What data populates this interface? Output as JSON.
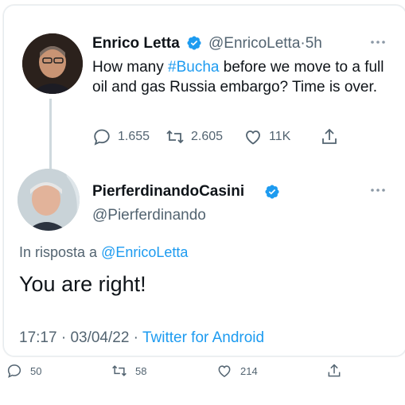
{
  "tweet1": {
    "author_name": "Enrico Letta",
    "handle": "@EnricoLetta",
    "separator": "·",
    "time": "5h",
    "text_before": "How many ",
    "hashtag": "#Bucha",
    "text_after": " before we move to a full oil and gas Russia embargo? Time is over.",
    "replies": "1.655",
    "retweets": "2.605",
    "likes": "11K"
  },
  "tweet2": {
    "author_name": "PierferdinandoCasini",
    "handle": "@Pierferdinando",
    "reply_prefix": "In risposta a ",
    "reply_to": "@EnricoLetta",
    "text": "You are right!",
    "time": "17:17",
    "separator1": " · ",
    "date": "03/04/22",
    "separator2": " · ",
    "source": "Twitter for Android"
  },
  "bottom_actions": {
    "replies": "50",
    "retweets": "58",
    "likes": "214"
  },
  "colors": {
    "accent": "#1d9bf0",
    "secondary_text": "#536471",
    "primary_text": "#0f1419",
    "thread_line": "#cfd9de"
  },
  "icons": [
    "verified-badge-icon",
    "more-icon",
    "reply-icon",
    "retweet-icon",
    "like-icon",
    "share-icon"
  ]
}
